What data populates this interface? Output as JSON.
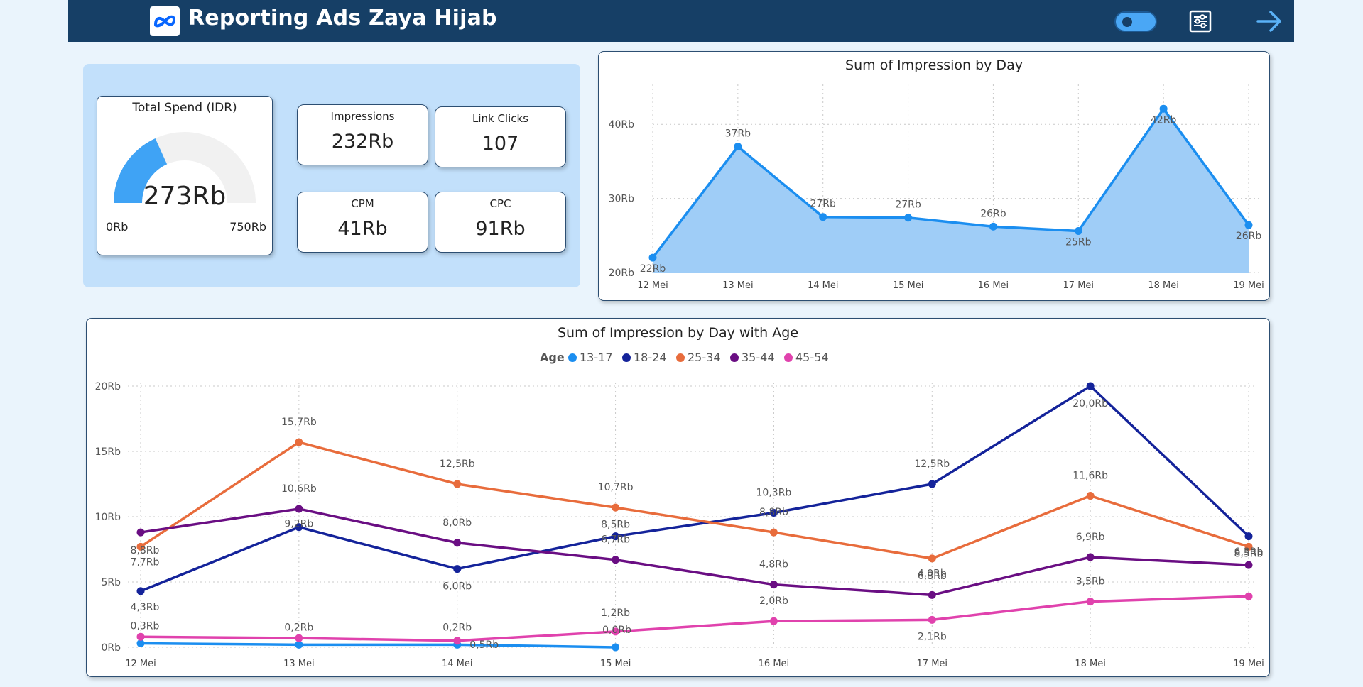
{
  "header": {
    "title": "Reporting Ads Zaya Hijab",
    "logo_icon": "meta-logo-icon",
    "toggle_icon": "toggle-switch-icon",
    "filter_icon": "sliders-icon",
    "next_icon": "arrow-right-icon",
    "background": "#163f66"
  },
  "kpis": {
    "spend": {
      "label": "Total Spend (IDR)",
      "value": "273Rb",
      "min": "0Rb",
      "max": "750Rb",
      "fraction": 0.364
    },
    "impressions": {
      "label": "Impressions",
      "value": "232Rb"
    },
    "link_clicks": {
      "label": "Link Clicks",
      "value": "107"
    },
    "cpm": {
      "label": "CPM",
      "value": "41Rb"
    },
    "cpc": {
      "label": "CPC",
      "value": "91Rb"
    }
  },
  "colors": {
    "accent": "#1b8ef0",
    "area_fill": "#9fcdf7",
    "age_13_17": "#1b8ef0",
    "age_18_24": "#14239a",
    "age_25_34": "#e86c3c",
    "age_35_44": "#6a0e83",
    "age_45_54": "#e042ad"
  },
  "chart_data": [
    {
      "type": "area",
      "title": "Sum of Impression by Day",
      "categories": [
        "12 Mei",
        "13 Mei",
        "14 Mei",
        "15 Mei",
        "16 Mei",
        "17 Mei",
        "18 Mei",
        "19 Mei"
      ],
      "values": [
        22,
        37,
        27.5,
        27.4,
        26.2,
        25.6,
        42.1,
        26.4
      ],
      "labels": [
        "22Rb",
        "37Rb",
        "27Rb",
        "27Rb",
        "26Rb",
        "25Rb",
        "42Rb",
        "26Rb"
      ],
      "yticks": [
        "20Rb",
        "30Rb",
        "40Rb"
      ],
      "ytick_values": [
        20,
        30,
        40
      ],
      "ylim": [
        20,
        45
      ],
      "grid": true
    },
    {
      "type": "line",
      "title": "Sum of Impression by Day with Age",
      "legend_title": "Age",
      "categories": [
        "12 Mei",
        "13 Mei",
        "14 Mei",
        "15 Mei",
        "16 Mei",
        "17 Mei",
        "18 Mei",
        "19 Mei"
      ],
      "yticks": [
        "0Rb",
        "5Rb",
        "10Rb",
        "15Rb",
        "20Rb"
      ],
      "ytick_values": [
        0,
        5,
        10,
        15,
        20
      ],
      "ylim": [
        0,
        20
      ],
      "grid": true,
      "legend_position": "top-center",
      "series": [
        {
          "name": "13-17",
          "color": "#1b8ef0",
          "values": [
            0.3,
            0.2,
            0.2,
            0.0,
            null,
            null,
            null,
            null
          ],
          "labels": [
            "0,3Rb",
            "0,2Rb",
            "0,2Rb",
            "0,0Rb",
            "",
            "",
            "",
            ""
          ]
        },
        {
          "name": "18-24",
          "color": "#14239a",
          "values": [
            4.3,
            9.2,
            6.0,
            8.5,
            10.3,
            12.5,
            20.0,
            8.5
          ],
          "labels": [
            "4,3Rb",
            "9,2Rb",
            "6,0Rb",
            "8,5Rb",
            "10,3Rb",
            "12,5Rb",
            "20,0Rb",
            "8,5Rb"
          ]
        },
        {
          "name": "25-34",
          "color": "#e86c3c",
          "values": [
            7.7,
            15.7,
            12.5,
            10.7,
            8.8,
            6.8,
            11.6,
            7.7
          ],
          "labels": [
            "7,7Rb",
            "15,7Rb",
            "12,5Rb",
            "10,7Rb",
            "8,8Rb",
            "6,8Rb",
            "11,6Rb",
            ""
          ]
        },
        {
          "name": "35-44",
          "color": "#6a0e83",
          "values": [
            8.8,
            10.6,
            8.0,
            6.7,
            4.8,
            4.0,
            6.9,
            6.3
          ],
          "labels": [
            "8,8Rb",
            "10,6Rb",
            "8,0Rb",
            "6,7Rb",
            "4,8Rb",
            "4,0Rb",
            "6,9Rb",
            "6,3Rb"
          ]
        },
        {
          "name": "45-54",
          "color": "#e042ad",
          "values": [
            0.8,
            0.7,
            0.5,
            1.2,
            2.0,
            2.1,
            3.5,
            3.9
          ],
          "labels": [
            "",
            "",
            "0,5Rb",
            "1,2Rb",
            "2,0Rb",
            "2,1Rb",
            "3,5Rb",
            ""
          ]
        }
      ]
    }
  ]
}
